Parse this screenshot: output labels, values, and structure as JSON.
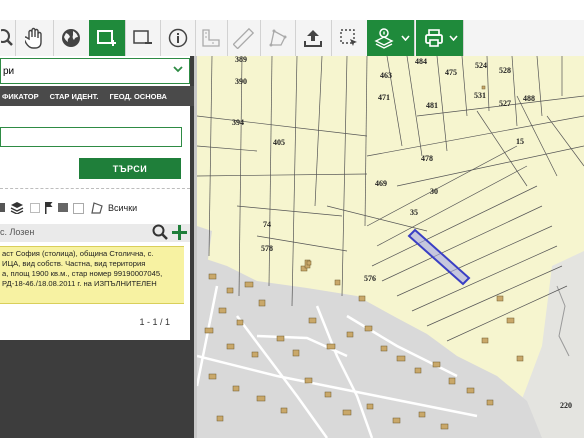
{
  "toolbar": {
    "buttons": [
      {
        "name": "zoom-icon"
      },
      {
        "name": "pan-hand-icon"
      },
      {
        "name": "globe-icon"
      },
      {
        "name": "select-add-icon",
        "active": true
      },
      {
        "name": "select-remove-icon"
      },
      {
        "name": "info-icon"
      },
      {
        "name": "measure-area-icon"
      },
      {
        "name": "ruler-icon"
      },
      {
        "name": "shape-icon"
      },
      {
        "name": "upload-icon"
      },
      {
        "name": "dashed-select-icon"
      },
      {
        "name": "layers-dropdown-icon",
        "dropdown": true
      },
      {
        "name": "print-icon",
        "dropdown": true
      }
    ],
    "accent_color": "#1f8a3b"
  },
  "panel": {
    "select_value": "ри",
    "tabs": [
      "ФИКАТОР",
      "СТАР ИДЕНТ.",
      "ГЕОД. ОСНОВА"
    ],
    "search_input_value": "",
    "search_button_label": "ТЪРСИ",
    "layer_filter_label": "Всички",
    "location_filter_value": "с. Лозен",
    "result_lines": [
      "аст София (столица), община Столична, с.",
      "ИЦА, вид собств. Частна, вид територия",
      "а, площ 1900 кв.м., стар номер 99190007045,",
      "РД-18-46./18.08.2011 г. на ИЗПЪЛНИТЕЛЕН"
    ],
    "pager": "1 - 1 / 1"
  },
  "map": {
    "parcel_labels": [
      {
        "t": "389"
      },
      {
        "t": "390"
      },
      {
        "t": "394"
      },
      {
        "t": "405"
      },
      {
        "t": "463"
      },
      {
        "t": "484"
      },
      {
        "t": "475"
      },
      {
        "t": "524"
      },
      {
        "t": "528"
      },
      {
        "t": "471"
      },
      {
        "t": "481"
      },
      {
        "t": "531"
      },
      {
        "t": "527"
      },
      {
        "t": "488"
      },
      {
        "t": "15"
      },
      {
        "t": "478"
      },
      {
        "t": "469"
      },
      {
        "t": "30"
      },
      {
        "t": "35"
      },
      {
        "t": "578"
      },
      {
        "t": "576"
      },
      {
        "t": "220"
      },
      {
        "t": "74"
      }
    ],
    "highlight_color": "#3a3fc4",
    "parcel_fill": "#f6f5cf",
    "urban_fill": "#d8d8d8"
  }
}
